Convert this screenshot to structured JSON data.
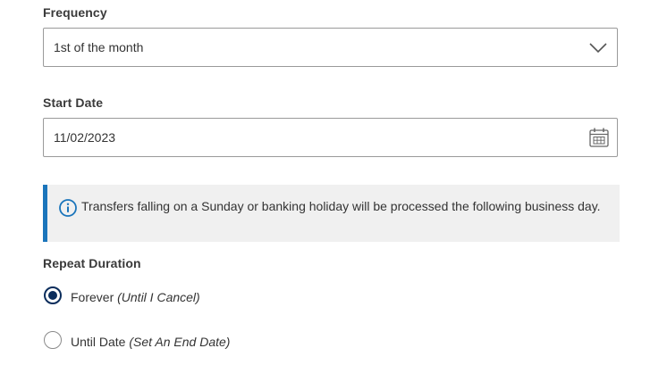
{
  "frequency": {
    "label": "Frequency",
    "value": "1st of the month",
    "icon": "chevron-down-icon"
  },
  "start_date": {
    "label": "Start Date",
    "value": "11/02/2023",
    "icon": "calendar-icon"
  },
  "notice": {
    "icon": "info-icon",
    "text": "Transfers falling on a Sunday or banking holiday will be processed the following business day.",
    "accent_color": "#1b75bb"
  },
  "repeat_duration": {
    "label": "Repeat Duration",
    "options": [
      {
        "label": "Forever",
        "note": "(Until I Cancel)",
        "selected": true
      },
      {
        "label": "Until Date",
        "note": "(Set An End Date)",
        "selected": false
      }
    ]
  },
  "colors": {
    "radio_selected": "#0b2d5c",
    "border": "#9a9a9a"
  }
}
